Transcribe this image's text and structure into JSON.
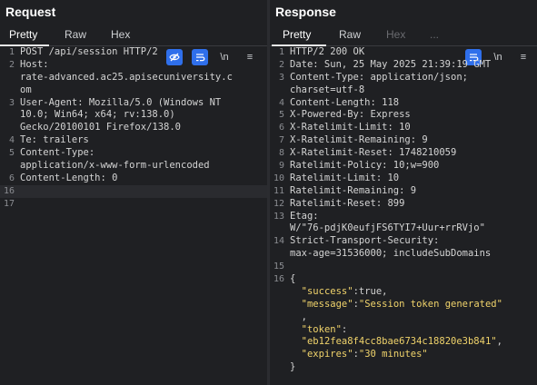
{
  "request": {
    "title": "Request",
    "tabs": [
      "Pretty",
      "Raw",
      "Hex"
    ],
    "tools": [
      "\\n",
      "≡"
    ],
    "lines": [
      {
        "n": "1",
        "rows": [
          "POST /api/session HTTP/2"
        ]
      },
      {
        "n": "2",
        "rows": [
          "Host:",
          "rate-advanced.ac25.apisecuniversity.c",
          "om"
        ]
      },
      {
        "n": "3",
        "rows": [
          "User-Agent: Mozilla/5.0 (Windows NT",
          "10.0; Win64; x64; rv:138.0)",
          "Gecko/20100101 Firefox/138.0"
        ]
      },
      {
        "n": "4",
        "rows": [
          "Te: trailers"
        ]
      },
      {
        "n": "5",
        "rows": [
          "Content-Type:",
          "application/x-www-form-urlencoded"
        ]
      },
      {
        "n": "6",
        "rows": [
          "Content-Length: 0"
        ]
      },
      {
        "n": "16",
        "rows": [
          ""
        ]
      },
      {
        "n": "17",
        "rows": [
          ""
        ]
      }
    ]
  },
  "response": {
    "title": "Response",
    "tabs": [
      "Pretty",
      "Raw",
      "Hex",
      "..."
    ],
    "tools": [
      "\\n",
      "≡"
    ],
    "lines": [
      {
        "n": "1",
        "rows": [
          "HTTP/2 200 OK"
        ]
      },
      {
        "n": "2",
        "rows": [
          "Date: Sun, 25 May 2025 21:39:19 GMT"
        ]
      },
      {
        "n": "3",
        "rows": [
          "Content-Type: application/json;",
          "charset=utf-8"
        ]
      },
      {
        "n": "4",
        "rows": [
          "Content-Length: 118"
        ]
      },
      {
        "n": "5",
        "rows": [
          "X-Powered-By: Express"
        ]
      },
      {
        "n": "6",
        "rows": [
          "X-Ratelimit-Limit: 10"
        ]
      },
      {
        "n": "7",
        "rows": [
          "X-Ratelimit-Remaining: 9"
        ]
      },
      {
        "n": "8",
        "rows": [
          "X-Ratelimit-Reset: 1748210059"
        ]
      },
      {
        "n": "9",
        "rows": [
          "Ratelimit-Policy: 10;w=900"
        ]
      },
      {
        "n": "10",
        "rows": [
          "Ratelimit-Limit: 10"
        ]
      },
      {
        "n": "11",
        "rows": [
          "Ratelimit-Remaining: 9"
        ]
      },
      {
        "n": "12",
        "rows": [
          "Ratelimit-Reset: 899"
        ]
      },
      {
        "n": "13",
        "rows": [
          "Etag:",
          "W/\"76-pdjK0eufjFS6TYI7+Uur+rrRVjo\""
        ]
      },
      {
        "n": "14",
        "rows": [
          "Strict-Transport-Security:",
          "max-age=31536000; includeSubDomains"
        ]
      },
      {
        "n": "15",
        "rows": [
          ""
        ]
      },
      {
        "n": "16",
        "rows": [
          "{"
        ]
      }
    ],
    "json": {
      "rows": [
        "  \"success\":true,",
        "  \"message\":\"Session token generated\"",
        "  ,",
        "  \"token\":",
        "  \"eb12fea8f4cc8bae6734c18820e3b841\",",
        "  \"expires\":\"30 minutes\"",
        "}"
      ]
    }
  }
}
